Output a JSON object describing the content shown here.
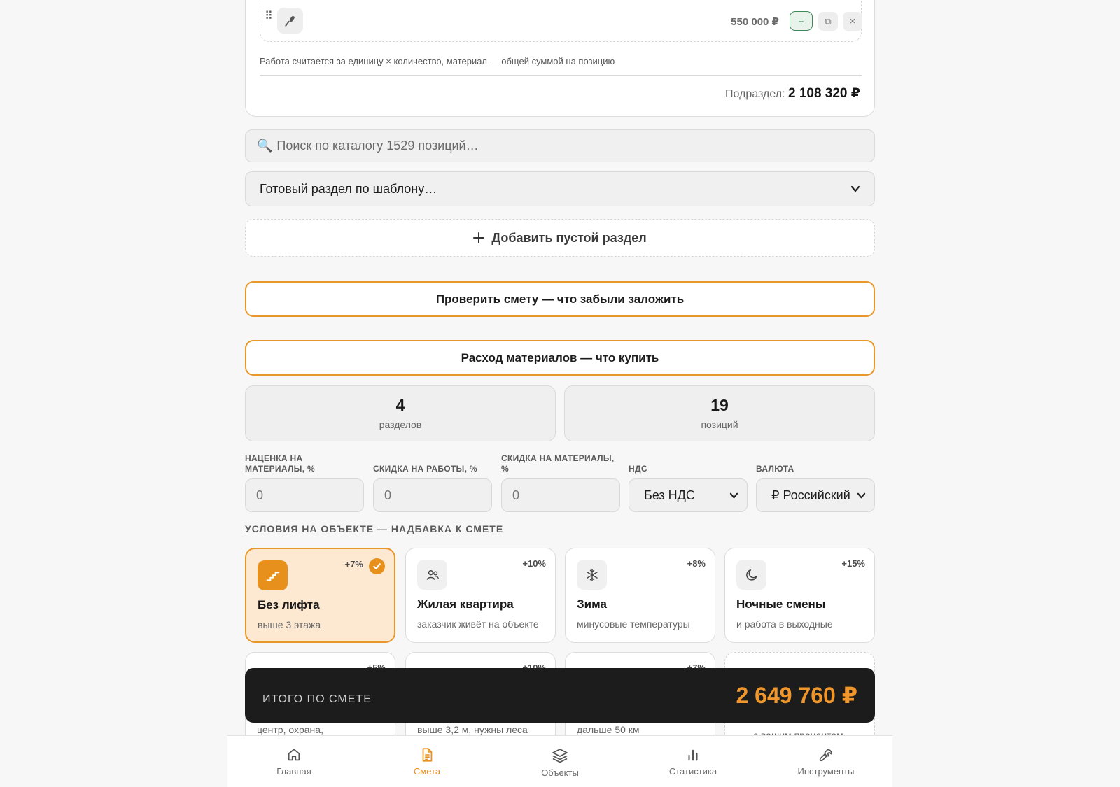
{
  "item_row": {
    "price": "550 000 ₽",
    "plus_label": "+",
    "copy_label": "⧉",
    "delete_label": "×",
    "drag_label": "⠿"
  },
  "note": "Работа считается за единицу × количество, материал — общей суммой на позицию",
  "subtotal": {
    "label": "Подраздел:",
    "value": "2 108 320 ₽"
  },
  "search": {
    "placeholder": "Поиск по каталогу 1529 позиций…"
  },
  "template_select": {
    "value": "Готовый раздел по шаблону…"
  },
  "add_section": {
    "label": "Добавить пустой раздел"
  },
  "check_button": {
    "label": "Проверить смету — что забыли заложить"
  },
  "materials_button": {
    "label": "Расход материалов — что купить"
  },
  "stats": [
    {
      "value": "4",
      "label": "разделов"
    },
    {
      "value": "19",
      "label": "позиций"
    }
  ],
  "settings": {
    "markup": {
      "label": "Наценка на материалы, %",
      "value": "0"
    },
    "work_discount": {
      "label": "Скидка на работы, %",
      "value": "0"
    },
    "material_discount": {
      "label": "Скидка на материалы, %",
      "value": "0"
    },
    "vat": {
      "label": "НДС",
      "value": "Без НДС"
    },
    "currency": {
      "label": "Валюта",
      "value": "₽ Российский"
    }
  },
  "conditions_title": "УСЛОВИЯ НА ОБЪЕКТЕ — НАДБАВКА К СМЕТЕ",
  "conditions": [
    {
      "title": "Без лифта",
      "subtitle": "выше 3 этажа",
      "percent": "+7%",
      "icon": "stairs-icon",
      "active": true
    },
    {
      "title": "Жилая квартира",
      "subtitle": "заказчик живёт на объекте",
      "percent": "+10%",
      "icon": "users-icon",
      "active": false
    },
    {
      "title": "Зима",
      "subtitle": "минусовые температуры",
      "percent": "+8%",
      "icon": "snowflake-icon",
      "active": false
    },
    {
      "title": "Ночные смены",
      "subtitle": "и работа в выходные",
      "percent": "+15%",
      "icon": "moon-icon",
      "active": false
    }
  ],
  "conditions_row2": [
    {
      "subtitle": "центр, охрана,",
      "percent": "+5%"
    },
    {
      "subtitle": "выше 3,2 м, нужны леса",
      "percent": "+10%"
    },
    {
      "subtitle": "дальше 50 км",
      "percent": "+7%"
    },
    {
      "subtitle": "с вашим процентом"
    }
  ],
  "total": {
    "label": "ИТОГО ПО СМЕТЕ",
    "value": "2 649 760 ₽"
  },
  "colors": {
    "accent": "#e8901c",
    "dark_bar": "#1c1c1c",
    "success": "#3d8a5a"
  },
  "nav": [
    {
      "label": "Главная",
      "icon": "home-icon",
      "active": false
    },
    {
      "label": "Смета",
      "icon": "document-icon",
      "active": true
    },
    {
      "label": "Объекты",
      "icon": "layers-icon",
      "active": false
    },
    {
      "label": "Статистика",
      "icon": "chart-icon",
      "active": false
    },
    {
      "label": "Инструменты",
      "icon": "wrench-icon",
      "active": false
    }
  ]
}
